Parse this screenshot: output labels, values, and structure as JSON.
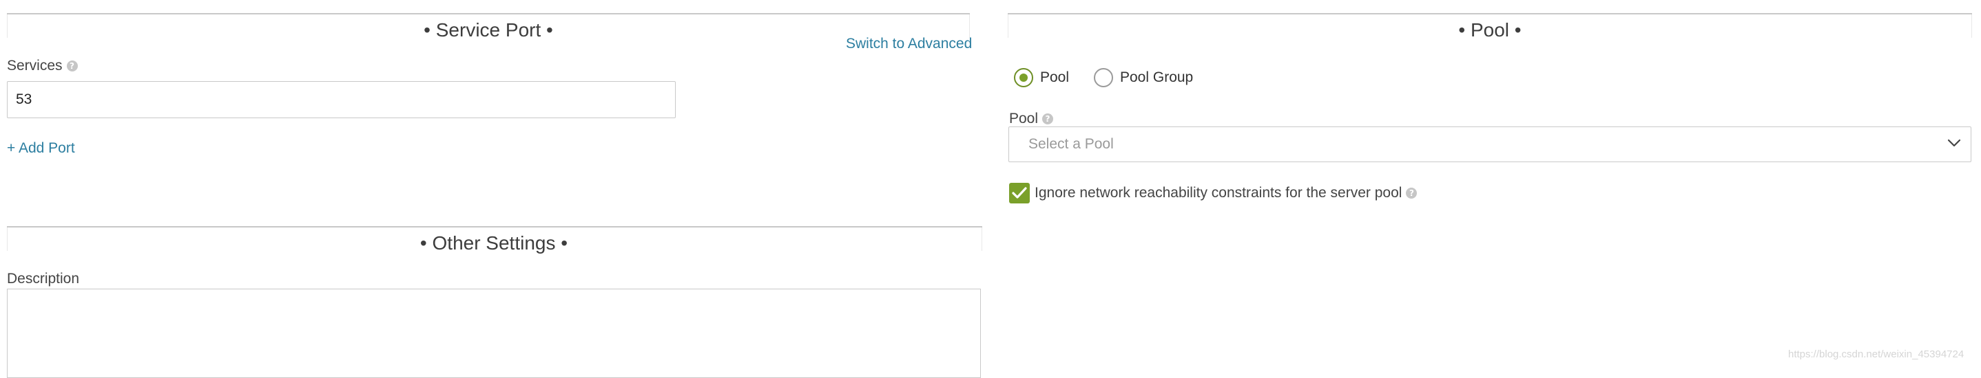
{
  "service_port": {
    "title": "• Service Port •",
    "switch_link": "Switch to Advanced",
    "services_label": "Services",
    "services_value": "53",
    "add_port": "+ Add Port"
  },
  "other_settings": {
    "title": "• Other Settings •",
    "description_label": "Description",
    "description_value": ""
  },
  "pool": {
    "title": "• Pool •",
    "radio_pool": "Pool",
    "radio_pool_group": "Pool Group",
    "selected": "Pool",
    "pool_label": "Pool",
    "select_placeholder": "Select a Pool",
    "ignore_checkbox_label": "Ignore network reachability constraints for the server pool",
    "ignore_checked": true
  },
  "watermark": "https://blog.csdn.net/weixin_45394724",
  "colors": {
    "accent_green": "#7aa02a",
    "link_blue": "#2c7ea0",
    "border_gray": "#c9c9c9"
  },
  "icons": {
    "help": "question-circle-icon",
    "chevron": "chevron-down-icon",
    "check": "checkmark-icon"
  }
}
